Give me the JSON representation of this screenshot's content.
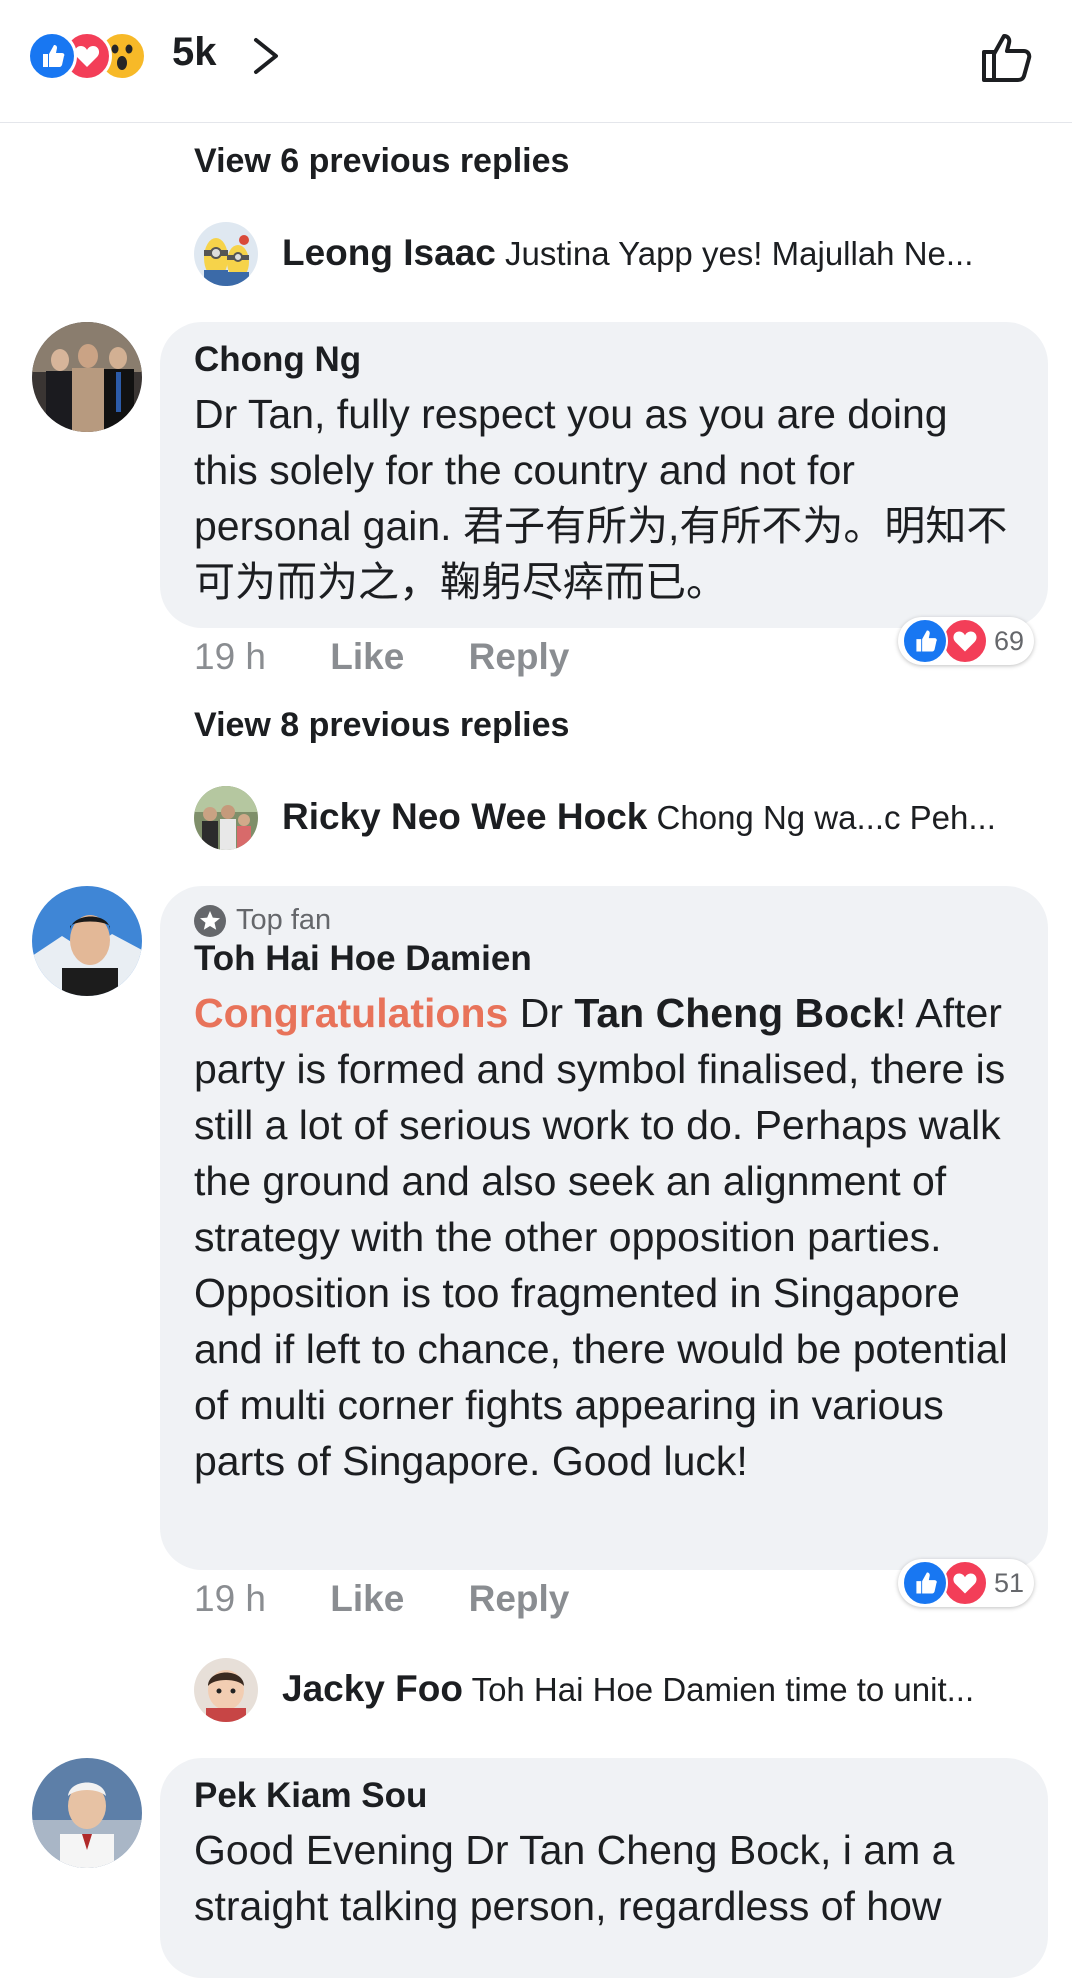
{
  "header": {
    "reaction_count": "5k",
    "reactions": [
      "like-icon",
      "love-icon",
      "wow-icon"
    ]
  },
  "threads": [
    {
      "view_previous": "View 6 previous replies",
      "latest_reply": {
        "name": "Leong Isaac",
        "text": "Justina Yapp yes! Majullah Ne..."
      }
    }
  ],
  "comments": [
    {
      "author": "Chong Ng",
      "text": "Dr Tan,  fully respect you as you are doing this solely for the country and not for personal gain. 君子有所为,有所不为。明知不可为而为之，鞠躬尽瘁而已。",
      "time": "19 h",
      "like_label": "Like",
      "reply_label": "Reply",
      "reaction_count": "69",
      "view_previous": "View 8 previous replies",
      "latest_reply": {
        "name": "Ricky Neo Wee Hock",
        "text": "Chong Ng wa...c Peh..."
      }
    },
    {
      "badge": "Top fan",
      "author": "Toh Hai Hoe Damien",
      "text_highlight": "Congratulations",
      "text_mid": " Dr ",
      "text_bold": "Tan Cheng Bock",
      "text_rest": "! After party is formed and symbol finalised, there is still a lot  of serious work to do. Perhaps walk the ground and also seek an alignment of strategy with the other opposition parties. Opposition is too fragmented in Singapore and if left to chance, there would be potential of multi corner fights appearing in various parts of Singapore. Good luck!",
      "time": "19 h",
      "like_label": "Like",
      "reply_label": "Reply",
      "reaction_count": "51",
      "latest_reply": {
        "name": "Jacky Foo",
        "text": "Toh Hai Hoe Damien time to unit..."
      }
    },
    {
      "author": "Pek Kiam Sou",
      "text": "Good Evening Dr Tan Cheng Bock, i am a straight talking person, regardless of how"
    }
  ],
  "colors": {
    "like_blue": "#1877f2",
    "love_red": "#f33e58",
    "wow_yellow": "#f7b928",
    "bubble_bg": "#f0f2f5",
    "highlight_orange": "#e8735a"
  }
}
